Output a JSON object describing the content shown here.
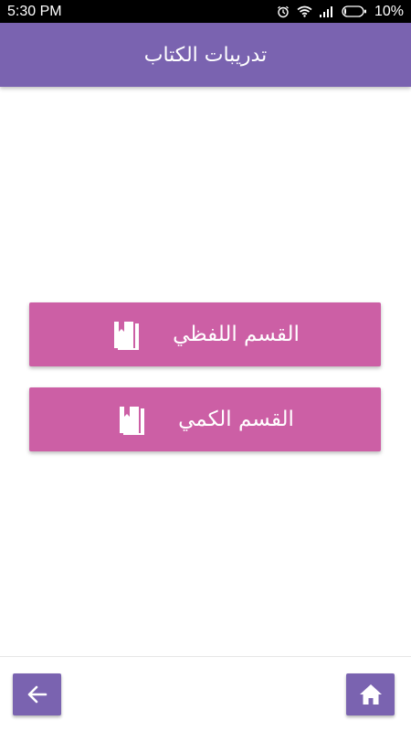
{
  "status_bar": {
    "time": "5:30 PM",
    "battery_percent": "10%",
    "battery_level": 0.1,
    "icons": [
      "alarm-icon",
      "wifi-icon",
      "signal-icon",
      "battery-icon"
    ]
  },
  "header": {
    "title": "تدريبات الكتاب"
  },
  "sections": [
    {
      "label": "القسم اللفظي",
      "icon": "book-icon"
    },
    {
      "label": "القسم الكمي",
      "icon": "book-icon"
    }
  ],
  "bottom_nav": {
    "back_icon": "arrow-left-icon",
    "home_icon": "home-icon"
  },
  "colors": {
    "primary": "#7a63b0",
    "button": "#cc5fa5",
    "status_bar": "#000000",
    "background": "#ffffff"
  }
}
